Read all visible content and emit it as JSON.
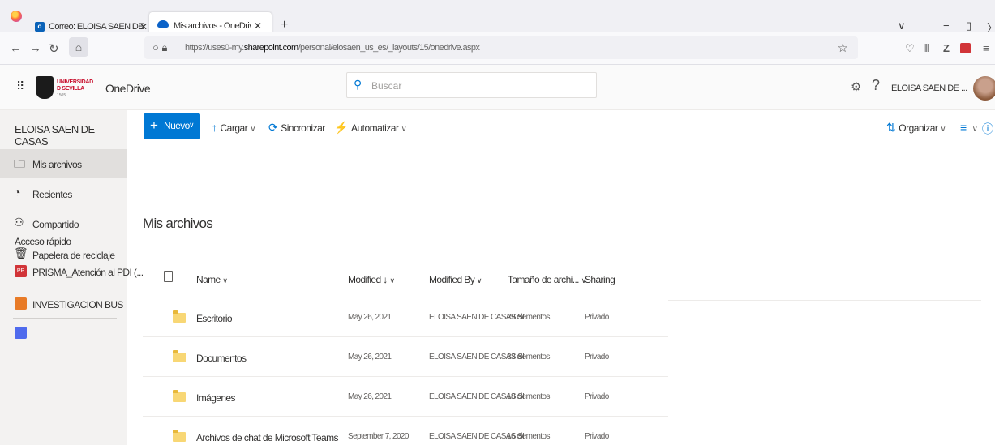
{
  "browser": {
    "tabs": [
      {
        "title": "Correo: ELOISA SAEN DE CASAS",
        "favicon": "outlook-icon"
      },
      {
        "title": "Mis archivos - OneDrive",
        "favicon": "onedrive-icon"
      }
    ],
    "url_prefix": "https://uses0-my.",
    "url_domain": "sharepoint.com",
    "url_path": "/personal/elosaen_us_es/_layouts/15/onedrive.aspx"
  },
  "header": {
    "logo_line1": "UNIVERSIDAD",
    "logo_line2": "D SEVILLA",
    "logo_year": "1505",
    "app_name": "OneDrive",
    "search_placeholder": "Buscar",
    "user_name": "ELOISA SAEN DE ..."
  },
  "sidebar": {
    "user": "ELOISA SAEN DE CASAS",
    "items": [
      {
        "label": "Mis archivos",
        "icon": "folder-icon"
      },
      {
        "label": "Recientes",
        "icon": "clock-icon"
      },
      {
        "label": "Compartido",
        "icon": "share-icon"
      },
      {
        "label": "Papelera de reciclaje",
        "icon": "recycle-bin-icon"
      }
    ],
    "quick_access_title": "Acceso rápido",
    "quick_access": [
      {
        "label": "PRISMA_Atención al PDI (...",
        "badge": "PP",
        "color": "#d13438"
      },
      {
        "label": "INVESTIGACION BUS",
        "badge": "",
        "color": "#e87b27"
      }
    ]
  },
  "commands": {
    "new": "Nuevo",
    "upload": "Cargar",
    "sync": "Sincronizar",
    "automate": "Automatizar",
    "organize": "Organizar"
  },
  "main": {
    "title": "Mis archivos",
    "columns": {
      "name": "Name",
      "modified": "Modified",
      "modified_by": "Modified By",
      "size": "Tamaño de archi...",
      "sharing": "Sharing"
    },
    "rows": [
      {
        "name": "Escritorio",
        "modified": "May 26, 2021",
        "by": "ELOISA SAEN DE CASAS SI",
        "size": "29 elementos",
        "sharing": "Privado"
      },
      {
        "name": "Documentos",
        "modified": "May 26, 2021",
        "by": "ELOISA SAEN DE CASAS SI",
        "size": "33 elementos",
        "sharing": "Privado"
      },
      {
        "name": "Imágenes",
        "modified": "May 26, 2021",
        "by": "ELOISA SAEN DE CASAS SI",
        "size": "18 elementos",
        "sharing": "Privado"
      },
      {
        "name": "Archivos de chat de Microsoft Teams",
        "modified": "September 7, 2020",
        "by": "ELOISA SAEN DE CASAS SI",
        "size": "16 elementos",
        "sharing": "Privado"
      }
    ]
  },
  "colors": {
    "accent": "#0078d4",
    "folder": "#f8d775",
    "sidebar_bg": "#f3f2f1"
  }
}
